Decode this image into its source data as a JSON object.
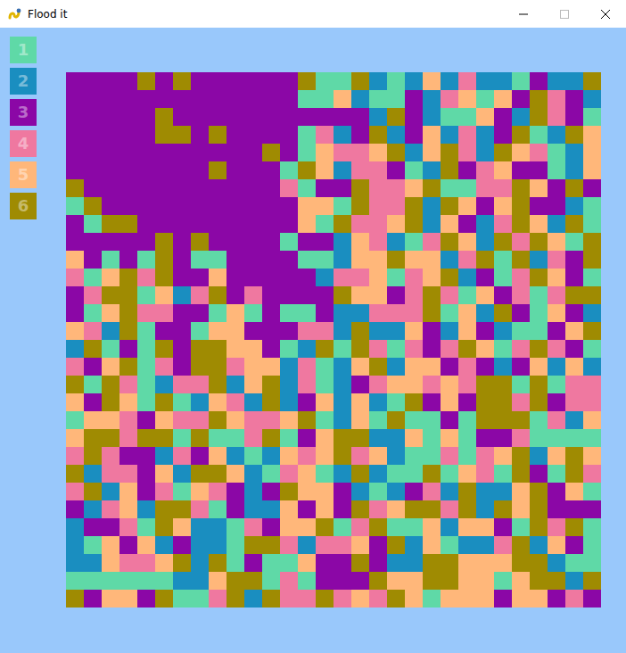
{
  "window": {
    "title": "Flood it"
  },
  "palette": [
    {
      "label": "1",
      "color": "#5fd9a7"
    },
    {
      "label": "2",
      "color": "#1a8ec0"
    },
    {
      "label": "3",
      "color": "#8b07a6"
    },
    {
      "label": "4",
      "color": "#ef78a0"
    },
    {
      "label": "5",
      "color": "#ffb77a"
    },
    {
      "label": "6",
      "color": "#9f8b02"
    }
  ],
  "board": {
    "rows": [
      [
        3,
        3,
        3,
        3,
        6,
        3,
        6,
        3,
        3,
        3,
        3,
        3,
        3,
        6,
        1,
        1,
        6,
        2,
        1,
        2,
        5,
        2,
        4,
        2,
        2,
        1,
        3,
        2,
        2,
        6
      ],
      [
        3,
        3,
        3,
        3,
        3,
        3,
        3,
        3,
        3,
        3,
        3,
        3,
        3,
        1,
        1,
        5,
        2,
        1,
        1,
        3,
        2,
        4,
        5,
        1,
        5,
        3,
        6,
        4,
        3,
        2
      ],
      [
        3,
        3,
        3,
        3,
        3,
        6,
        3,
        3,
        3,
        3,
        3,
        3,
        3,
        3,
        3,
        3,
        3,
        2,
        6,
        3,
        2,
        1,
        1,
        5,
        3,
        2,
        6,
        4,
        3,
        1
      ],
      [
        3,
        3,
        3,
        3,
        3,
        6,
        6,
        3,
        6,
        3,
        3,
        3,
        3,
        1,
        4,
        2,
        3,
        6,
        2,
        3,
        5,
        2,
        4,
        2,
        3,
        6,
        1,
        2,
        6,
        5
      ],
      [
        3,
        3,
        3,
        3,
        3,
        3,
        3,
        3,
        3,
        3,
        3,
        6,
        3,
        1,
        5,
        4,
        4,
        5,
        6,
        2,
        5,
        6,
        4,
        2,
        6,
        5,
        4,
        1,
        2,
        5
      ],
      [
        3,
        3,
        3,
        3,
        3,
        3,
        3,
        3,
        6,
        3,
        3,
        3,
        1,
        6,
        5,
        2,
        4,
        4,
        3,
        1,
        2,
        6,
        3,
        4,
        5,
        3,
        3,
        1,
        2,
        5
      ],
      [
        6,
        3,
        3,
        3,
        3,
        3,
        3,
        3,
        3,
        3,
        3,
        3,
        4,
        1,
        3,
        3,
        6,
        4,
        4,
        5,
        6,
        1,
        1,
        4,
        4,
        6,
        5,
        3,
        6,
        3
      ],
      [
        1,
        6,
        3,
        3,
        3,
        3,
        3,
        3,
        3,
        3,
        3,
        3,
        3,
        5,
        5,
        1,
        6,
        4,
        4,
        6,
        2,
        6,
        5,
        3,
        5,
        6,
        3,
        3,
        2,
        1
      ],
      [
        3,
        1,
        6,
        6,
        3,
        3,
        3,
        3,
        3,
        3,
        3,
        3,
        3,
        5,
        1,
        6,
        4,
        4,
        5,
        6,
        2,
        5,
        3,
        2,
        4,
        6,
        5,
        2,
        6,
        1
      ],
      [
        3,
        3,
        3,
        3,
        3,
        6,
        3,
        6,
        3,
        3,
        3,
        3,
        1,
        3,
        3,
        2,
        5,
        4,
        2,
        1,
        4,
        6,
        5,
        2,
        6,
        4,
        6,
        5,
        1,
        6
      ],
      [
        5,
        3,
        1,
        3,
        1,
        6,
        3,
        1,
        1,
        3,
        3,
        3,
        3,
        1,
        1,
        2,
        5,
        5,
        6,
        5,
        5,
        2,
        4,
        6,
        1,
        6,
        2,
        4,
        3,
        6
      ],
      [
        4,
        1,
        5,
        6,
        4,
        6,
        3,
        3,
        5,
        3,
        3,
        3,
        3,
        3,
        2,
        4,
        4,
        5,
        1,
        4,
        5,
        6,
        2,
        3,
        1,
        4,
        6,
        5,
        3,
        1
      ],
      [
        3,
        4,
        6,
        6,
        1,
        5,
        2,
        4,
        6,
        3,
        4,
        3,
        3,
        3,
        3,
        6,
        5,
        5,
        3,
        4,
        6,
        4,
        1,
        5,
        3,
        4,
        1,
        4,
        6,
        6
      ],
      [
        3,
        1,
        5,
        6,
        4,
        4,
        3,
        3,
        1,
        5,
        1,
        3,
        1,
        1,
        3,
        2,
        2,
        4,
        4,
        4,
        6,
        1,
        5,
        2,
        6,
        3,
        1,
        5,
        3,
        2
      ],
      [
        5,
        4,
        2,
        6,
        1,
        3,
        3,
        1,
        5,
        5,
        3,
        3,
        3,
        4,
        4,
        2,
        6,
        2,
        2,
        5,
        3,
        2,
        5,
        3,
        2,
        1,
        1,
        3,
        5,
        6
      ],
      [
        2,
        6,
        1,
        3,
        1,
        6,
        3,
        6,
        6,
        5,
        5,
        3,
        1,
        2,
        6,
        1,
        6,
        4,
        1,
        4,
        3,
        4,
        6,
        5,
        1,
        4,
        6,
        4,
        3,
        1
      ],
      [
        4,
        3,
        5,
        6,
        1,
        4,
        3,
        6,
        6,
        4,
        5,
        5,
        2,
        4,
        1,
        2,
        5,
        6,
        2,
        5,
        5,
        3,
        4,
        3,
        2,
        3,
        5,
        2,
        5,
        2
      ],
      [
        6,
        1,
        6,
        4,
        1,
        2,
        4,
        4,
        6,
        2,
        5,
        6,
        2,
        4,
        1,
        2,
        3,
        4,
        5,
        5,
        4,
        5,
        4,
        6,
        6,
        1,
        6,
        1,
        4,
        4
      ],
      [
        5,
        3,
        6,
        5,
        1,
        6,
        1,
        2,
        5,
        4,
        2,
        6,
        2,
        3,
        5,
        2,
        5,
        2,
        1,
        6,
        3,
        5,
        3,
        6,
        6,
        4,
        6,
        3,
        4,
        4
      ],
      [
        1,
        5,
        5,
        4,
        3,
        5,
        4,
        4,
        6,
        5,
        4,
        4,
        5,
        6,
        1,
        2,
        5,
        1,
        6,
        1,
        1,
        3,
        1,
        6,
        6,
        6,
        1,
        4,
        2,
        5
      ],
      [
        5,
        6,
        6,
        4,
        6,
        6,
        1,
        6,
        1,
        1,
        4,
        6,
        1,
        3,
        5,
        6,
        6,
        2,
        2,
        5,
        1,
        5,
        1,
        3,
        3,
        4,
        1,
        1,
        1,
        1
      ],
      [
        4,
        6,
        4,
        3,
        3,
        2,
        4,
        3,
        5,
        2,
        1,
        2,
        5,
        4,
        5,
        6,
        4,
        5,
        2,
        1,
        1,
        4,
        1,
        4,
        5,
        6,
        2,
        5,
        6,
        5
      ],
      [
        6,
        2,
        4,
        4,
        3,
        5,
        2,
        6,
        6,
        5,
        2,
        1,
        4,
        5,
        1,
        2,
        6,
        2,
        1,
        1,
        6,
        1,
        5,
        4,
        1,
        6,
        3,
        1,
        6,
        4
      ],
      [
        4,
        6,
        2,
        5,
        3,
        4,
        1,
        5,
        4,
        3,
        2,
        3,
        6,
        5,
        5,
        3,
        2,
        1,
        2,
        3,
        4,
        2,
        6,
        2,
        2,
        5,
        6,
        3,
        5,
        1
      ],
      [
        3,
        2,
        4,
        5,
        2,
        6,
        6,
        4,
        1,
        3,
        2,
        2,
        5,
        3,
        5,
        3,
        6,
        4,
        5,
        6,
        6,
        4,
        6,
        2,
        6,
        5,
        6,
        3,
        3,
        3
      ],
      [
        2,
        3,
        3,
        4,
        1,
        6,
        5,
        2,
        2,
        1,
        4,
        3,
        5,
        5,
        6,
        1,
        4,
        6,
        1,
        1,
        5,
        2,
        5,
        5,
        3,
        1,
        6,
        4,
        6,
        1
      ],
      [
        2,
        1,
        5,
        3,
        5,
        2,
        3,
        2,
        2,
        1,
        6,
        6,
        4,
        2,
        4,
        4,
        5,
        3,
        6,
        2,
        5,
        1,
        2,
        2,
        4,
        6,
        2,
        5,
        3,
        1
      ],
      [
        2,
        2,
        5,
        4,
        4,
        5,
        6,
        2,
        6,
        1,
        3,
        1,
        1,
        5,
        3,
        3,
        6,
        3,
        2,
        2,
        6,
        6,
        5,
        5,
        5,
        6,
        6,
        2,
        1,
        1
      ],
      [
        1,
        1,
        1,
        1,
        1,
        1,
        2,
        2,
        5,
        6,
        6,
        1,
        4,
        1,
        3,
        3,
        3,
        6,
        5,
        5,
        6,
        6,
        5,
        5,
        1,
        5,
        6,
        6,
        2,
        6
      ],
      [
        6,
        3,
        5,
        5,
        3,
        6,
        1,
        1,
        4,
        6,
        2,
        6,
        4,
        4,
        6,
        4,
        5,
        4,
        6,
        5,
        1,
        5,
        5,
        5,
        3,
        5,
        5,
        3,
        4,
        3
      ]
    ]
  }
}
